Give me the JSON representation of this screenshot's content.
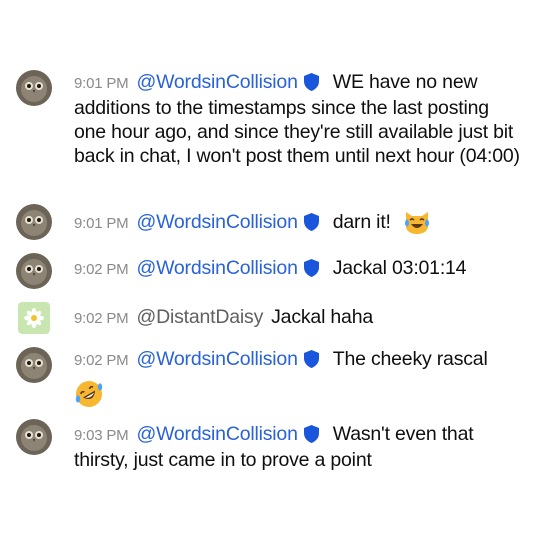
{
  "messages": [
    {
      "time": "9:01 PM",
      "author": "@WordsinCollision",
      "verified": true,
      "text": "WE have no new additions to the timestamps since the last posting one hour ago, and since they're still available just bit back in chat, I won't post them until next hour (04:00)"
    },
    {
      "time": "9:01 PM",
      "author": "@WordsinCollision",
      "verified": true,
      "text": "darn it!",
      "emoji": "cat-tears-of-joy-emoji"
    },
    {
      "time": "9:02 PM",
      "author": "@WordsinCollision",
      "verified": true,
      "text": "Jackal 03:01:14"
    },
    {
      "time": "9:02 PM",
      "author": "@DistantDaisy",
      "verified": false,
      "text": "Jackal haha"
    },
    {
      "time": "9:02 PM",
      "author": "@WordsinCollision",
      "verified": true,
      "text": "The cheeky rascal",
      "emoji": "rolling-on-floor-laughing-emoji"
    },
    {
      "time": "9:03 PM",
      "author": "@WordsinCollision",
      "verified": true,
      "text": "Wasn't even that thirsty, just came in to prove a point"
    }
  ],
  "colors": {
    "author_verified": "#2962d9",
    "author_plain": "#606060",
    "timestamp": "#8a8a8a",
    "badge": "#1a56db"
  }
}
